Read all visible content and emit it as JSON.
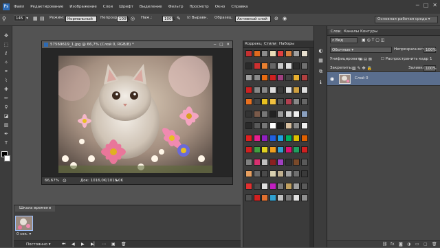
{
  "menu": {
    "items": [
      "Файл",
      "Редактирование",
      "Изображение",
      "Слои",
      "Шрифт",
      "Выделение",
      "Фильтр",
      "Просмотр",
      "Окно",
      "Справка"
    ]
  },
  "options": {
    "size": "145",
    "mode_label": "Режим:",
    "mode_value": "Нормальный",
    "opacity_label": "Непрозр.:",
    "opacity_value": "100%",
    "pressure_label": "Наж.:",
    "pressure_value": "100%",
    "align_label": "Выравн.",
    "sample_label": "Образец:",
    "sample_value": "Активный слой",
    "workspace_value": "Основная рабочая среда"
  },
  "document": {
    "title": "57569619_1.jpg @ 66,7% (Слой 0, RGB/8) *",
    "zoom": "66,67%",
    "doc_size": "Док: 1016,0K/1016,0K"
  },
  "timeline": {
    "tab_label": "Шкала времени",
    "frame_time": "0 сек.",
    "loop_value": "Постоянно"
  },
  "swatch_panel": {
    "tabs": [
      "Коррекц",
      "Стили",
      "Наборы"
    ],
    "active_tab": 1
  },
  "layers_panel": {
    "tabs": [
      "Слои",
      "Каналы",
      "Контуры"
    ],
    "active_tab": 0,
    "filter_value": "Вид",
    "blend_value": "Обычные",
    "opacity_label": "Непрозрачность:",
    "opacity_value": "100%",
    "unify_label": "Унифицировать:",
    "propagate_label": "Распространить кадр 1",
    "lock_label": "Закрепить:",
    "fill_label": "Заливка:",
    "fill_value": "100%",
    "layers": [
      {
        "name": "Слой 0",
        "selected": true
      }
    ]
  },
  "colors": {
    "foreground": "#000000",
    "background": "#ffffff",
    "selection": "#5a6e8e"
  },
  "style_swatches": [
    "#c43030",
    "#e06a1e",
    "#8c8c8c",
    "#e9ddb9",
    "#e04040",
    "#d88040",
    "#a0a0a0",
    "#e8e0d0",
    "#2a2a2a",
    "#cc3030",
    "#e88030",
    "#666",
    "#c8c8c8",
    "#e0e0e0",
    "#2c2c2c",
    "#707070",
    "#a0a0a0",
    "#8a8a8a",
    "#e86b12",
    "#d02020",
    "#a04080",
    "#444",
    "#e8b030",
    "#b04040",
    "#cc2222",
    "#888",
    "#888",
    "#ddd",
    "#3a3a3a",
    "#e0e0e0",
    "#cfa040",
    "#ddd",
    "#e87020",
    "#444",
    "#e8c020",
    "#f0c040",
    "#555",
    "#b04050",
    "#888",
    "#666",
    "#333",
    "#7a5a4a",
    "#777",
    "#222",
    "#9a9a9a",
    "#d8d8d8",
    "#eee",
    "#8aa0c0",
    "#2a2a2a",
    "#5a5a5a",
    "#777",
    "#ffffff",
    "#1d1d1d",
    "#d8c0a0",
    "#8a8a8a",
    "#f0f0f0",
    "#e02020",
    "#e81f8f",
    "#9020c0",
    "#2060e0",
    "#20a0e0",
    "#00b060",
    "#e0c000",
    "#e06000",
    "#d02020",
    "#40a040",
    "#e0d020",
    "#f0a020",
    "#30a0d0",
    "#e01070",
    "#20a060",
    "#d02020",
    "#808080",
    "#d83070",
    "#c0c0c0",
    "#8a2020",
    "#a040c0",
    "#303030",
    "#7a4a2a",
    "#5a5a5a",
    "#e8a060",
    "#6a6a6a",
    "#4a4a4a",
    "#d8d0b0",
    "#c0b090",
    "#a0a0a0",
    "#707070",
    "#3a3a3a",
    "#e03030",
    "#4a4a4a",
    "#e0e0e0",
    "#c020c0",
    "#7a7a7a",
    "#c0a060",
    "#a0a0a0",
    "#5a5a5a",
    "#505050",
    "#d02020",
    "#e07030",
    "#30a0d0",
    "#c0c0c0",
    "#7a7a7a",
    "#e0e0e0",
    "#909090"
  ]
}
